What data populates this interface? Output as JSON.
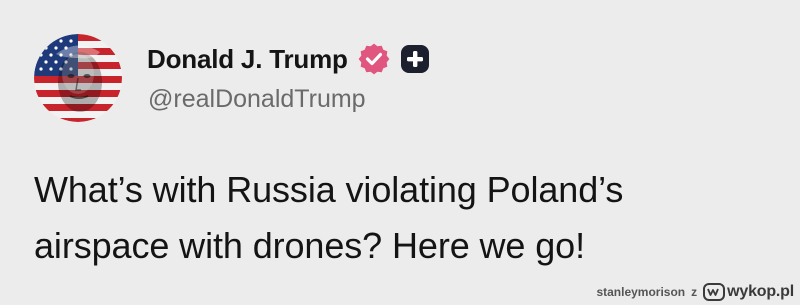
{
  "post": {
    "author": {
      "display_name": "Donald J. Trump",
      "handle": "@realDonaldTrump",
      "avatar_icon": "flag-portrait-avatar",
      "verified_icon": "verified-badge-icon",
      "plus_icon": "plus-badge-icon"
    },
    "text_lines": [
      "What’s with Russia violating Poland’s",
      "airspace with drones? Here we go!"
    ]
  },
  "watermark": {
    "user": "stanleymorison",
    "separator": "z",
    "site": "wykop.pl"
  },
  "colors": {
    "background": "#ececec",
    "verified": "#e0567f",
    "text": "#141414",
    "handle": "#6a6a6a"
  }
}
